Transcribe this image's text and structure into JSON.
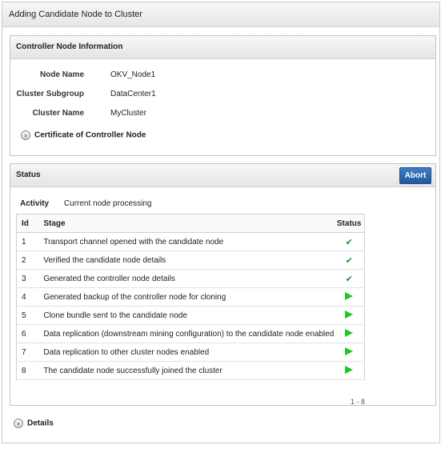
{
  "window_title": "Adding Candidate Node to Cluster",
  "controller_section": {
    "title": "Controller Node Information",
    "fields": [
      {
        "label": "Node Name",
        "value": "OKV_Node1"
      },
      {
        "label": "Cluster Subgroup",
        "value": "DataCenter1"
      },
      {
        "label": "Cluster Name",
        "value": "MyCluster"
      }
    ],
    "certificate_link": "Certificate of Controller Node"
  },
  "status_section": {
    "title": "Status",
    "abort_label": "Abort",
    "activity_label": "Activity",
    "activity_value": "Current node processing",
    "columns": {
      "id": "Id",
      "stage": "Stage",
      "status": "Status"
    },
    "rows": [
      {
        "id": "1",
        "stage": "Transport channel opened with the candidate node",
        "status": "check"
      },
      {
        "id": "2",
        "stage": "Verified the candidate node details",
        "status": "check"
      },
      {
        "id": "3",
        "stage": "Generated the controller node details",
        "status": "check"
      },
      {
        "id": "4",
        "stage": "Generated backup of the controller node for cloning",
        "status": "flag"
      },
      {
        "id": "5",
        "stage": "Clone bundle sent to the candidate node",
        "status": "flag"
      },
      {
        "id": "6",
        "stage": "Data replication (downstream mining configuration) to the candidate node enabled",
        "status": "flag"
      },
      {
        "id": "7",
        "stage": "Data replication to other cluster nodes enabled",
        "status": "flag"
      },
      {
        "id": "8",
        "stage": "The candidate node successfully joined the cluster",
        "status": "flag"
      }
    ],
    "pager": "1 - 8"
  },
  "details_label": "Details",
  "colors": {
    "check": "#2e8b2e",
    "flag": "#1fc71f",
    "abort": "#2a6bb3"
  }
}
